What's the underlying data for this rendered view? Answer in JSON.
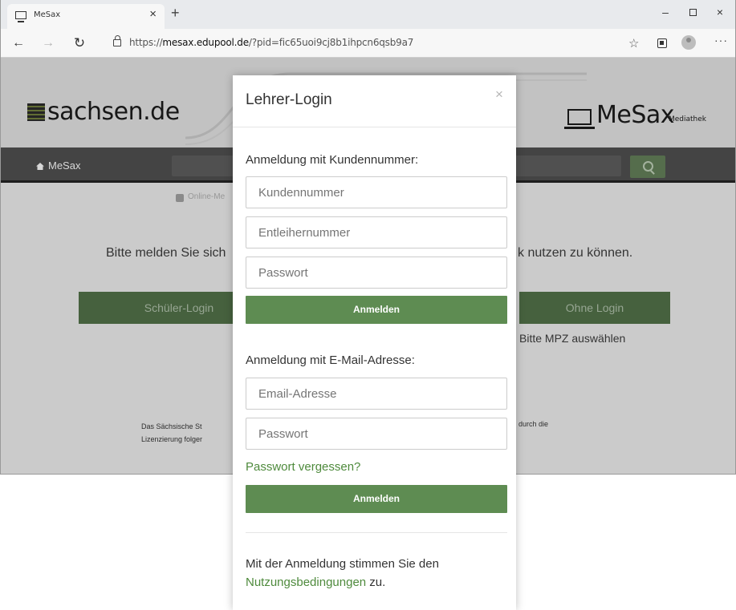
{
  "browser": {
    "tab_title": "MeSax",
    "tab_close": "×",
    "new_tab": "+",
    "url_prefix": "https://",
    "url_host": "mesax.edupool.de",
    "url_rest": "/?pid=fic65uoi9cj8b1ihpcn6qsb9a7",
    "star": "☆",
    "more": "···",
    "back": "←",
    "forward": "→",
    "reload": "↻",
    "win_min": "–",
    "win_close": "×"
  },
  "site": {
    "sachsen_brand": "sachsen.de",
    "mesax_brand": "MeSax",
    "mediathek": "Mediathek",
    "nav_home": "MeSax",
    "online_label": "Online-Me",
    "hint_left": "Bitte melden Sie sich",
    "hint_right": "k nutzen zu können.",
    "btn_schueler": "Schüler-Login",
    "btn_ohne": "Ohne Login",
    "mpz_hint": "Bitte MPZ auswählen",
    "info_left_1": "Das Sächsische St",
    "info_left_2": "Lizenzierung folger",
    "info_right": "durch die"
  },
  "modal": {
    "title": "Lehrer-Login",
    "close": "×",
    "section_kunde": "Anmeldung mit Kundennummer:",
    "kunde_placeholder": "Kundennummer",
    "entleiher_placeholder": "Entleihernummer",
    "passwort_placeholder": "Passwort",
    "submit_label": "Anmelden",
    "section_email": "Anmeldung mit E-Mail-Adresse:",
    "email_placeholder": "Email-Adresse",
    "passwort2_placeholder": "Passwort",
    "forgot": "Passwort vergessen?",
    "submit2_label": "Anmelden",
    "consent_before": "Mit der Anmeldung stimmen Sie den",
    "consent_link": "Nutzungsbedingungen",
    "consent_after": " zu."
  },
  "colors": {
    "accent_green": "#5e8c52",
    "link_green": "#4e8a3c",
    "nav_dark": "#4c4c4c"
  }
}
